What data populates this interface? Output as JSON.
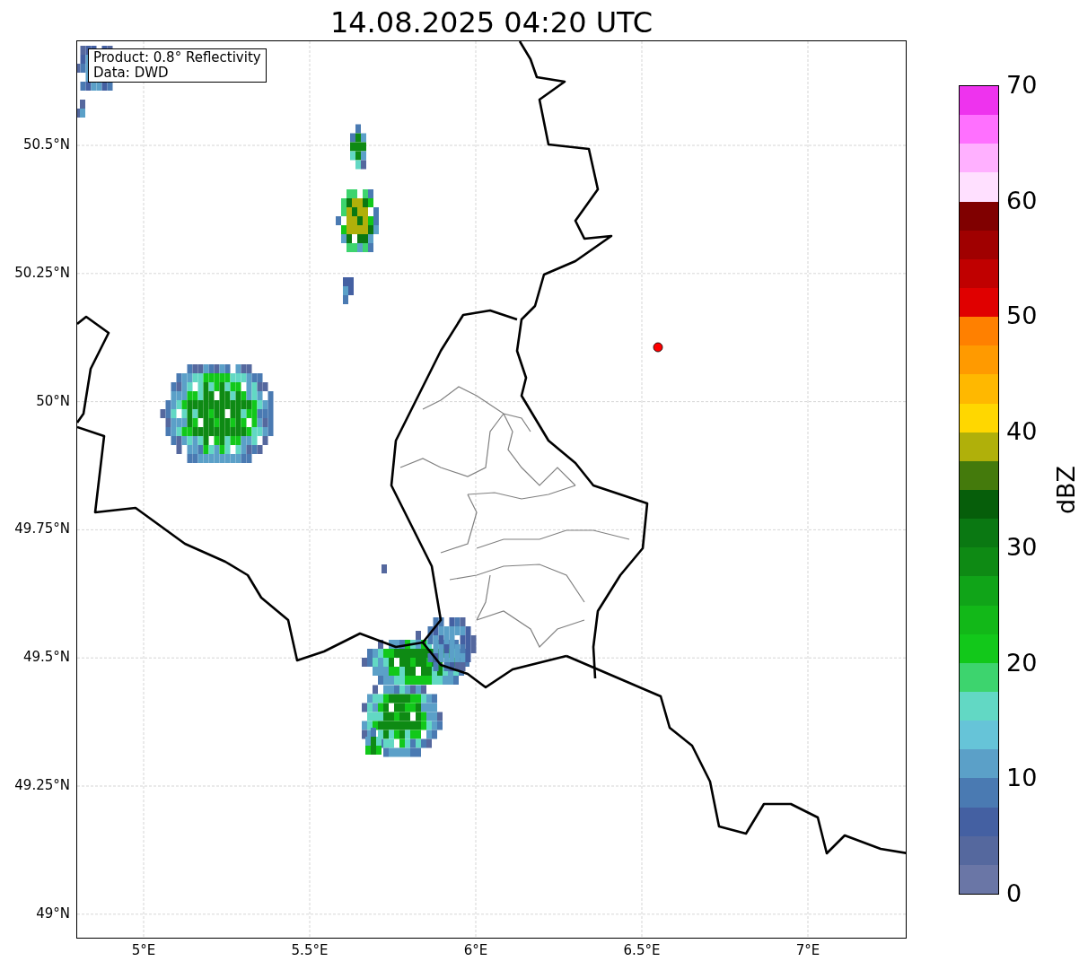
{
  "title": "14.08.2025 04:20 UTC",
  "info_box": {
    "lines": [
      "Product: 0.8° Reflectivity",
      "Data: DWD"
    ]
  },
  "map": {
    "x_ticks": [
      "5°E",
      "5.5°E",
      "6°E",
      "6.5°E",
      "7°E"
    ],
    "y_ticks": [
      "50.5°N",
      "50.25°N",
      "50°N",
      "49.75°N",
      "49.5°N",
      "49.25°N",
      "49°N"
    ]
  },
  "colorbar": {
    "label": "dBZ",
    "ticks": [
      "70",
      "60",
      "50",
      "40",
      "30",
      "20",
      "10",
      "0"
    ],
    "bins": [
      {
        "color": "#ee33ee"
      },
      {
        "color": "#ff70ff"
      },
      {
        "color": "#ffb0ff"
      },
      {
        "color": "#ffe0ff"
      },
      {
        "color": "#800000"
      },
      {
        "color": "#a00000"
      },
      {
        "color": "#c00000"
      },
      {
        "color": "#e00000"
      },
      {
        "color": "#ff8000"
      },
      {
        "color": "#ff9a00"
      },
      {
        "color": "#ffb800"
      },
      {
        "color": "#ffd700"
      },
      {
        "color": "#b0b00a"
      },
      {
        "color": "#447a0c"
      },
      {
        "color": "#065e0a"
      },
      {
        "color": "#0a7812"
      },
      {
        "color": "#0e8a14"
      },
      {
        "color": "#10a418"
      },
      {
        "color": "#12b818"
      },
      {
        "color": "#12c81a"
      },
      {
        "color": "#3dd46e"
      },
      {
        "color": "#62d8c4"
      },
      {
        "color": "#66c4d8"
      },
      {
        "color": "#5ba0c8"
      },
      {
        "color": "#4a7ab2"
      },
      {
        "color": "#4460a2"
      },
      {
        "color": "#55689e"
      },
      {
        "color": "#6a76a6"
      }
    ]
  }
}
